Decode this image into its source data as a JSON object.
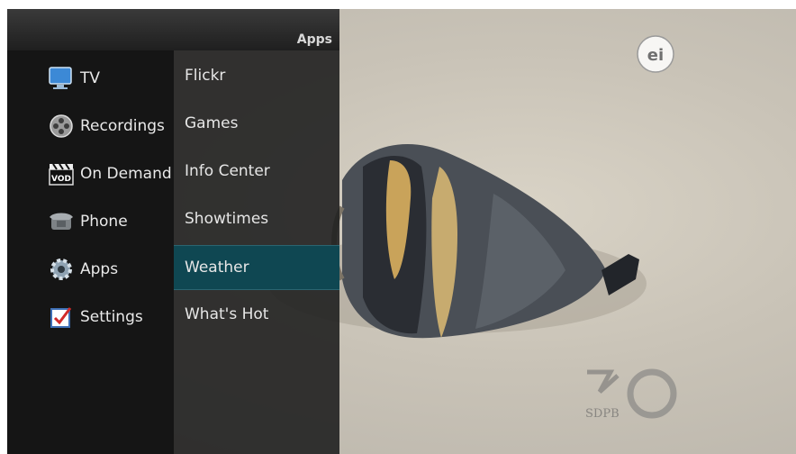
{
  "header": {
    "title": "Apps"
  },
  "main_menu": {
    "items": [
      {
        "label": "TV",
        "icon": "tv-icon"
      },
      {
        "label": "Recordings",
        "icon": "film-reel-icon"
      },
      {
        "label": "On Demand",
        "icon": "vod-clapperboard-icon"
      },
      {
        "label": "Phone",
        "icon": "phone-icon"
      },
      {
        "label": "Apps",
        "icon": "gear-icon"
      },
      {
        "label": "Settings",
        "icon": "checkbox-icon"
      }
    ]
  },
  "apps_menu": {
    "items": [
      {
        "label": "Flickr"
      },
      {
        "label": "Games"
      },
      {
        "label": "Info Center"
      },
      {
        "label": "Showtimes"
      },
      {
        "label": "Weather",
        "selected": true
      },
      {
        "label": "What's Hot"
      }
    ]
  },
  "overlays": {
    "rating_badge": "ei",
    "watermark": "SDPB"
  },
  "colors": {
    "selection": "#0f4752",
    "panel": "#151515"
  }
}
